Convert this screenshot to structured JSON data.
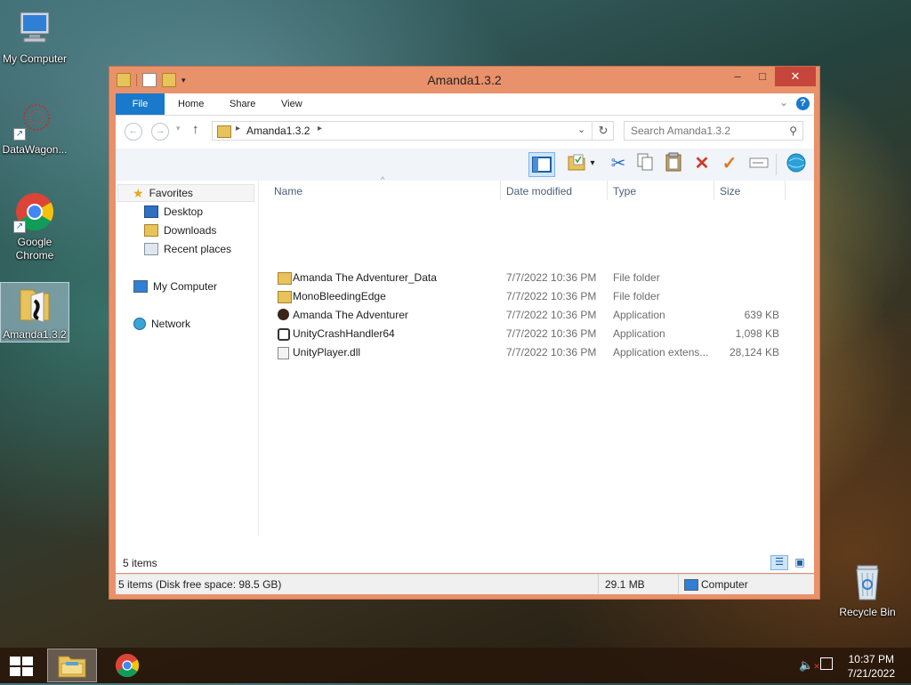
{
  "desktop": {
    "icons": [
      {
        "label": "My Computer",
        "icon": "computer-icon"
      },
      {
        "label": "DataWagon...",
        "icon": "datawagon-icon"
      },
      {
        "label": "Google Chrome",
        "icon": "chrome-icon"
      },
      {
        "label": "Amanda1.3.2",
        "icon": "folder-icon"
      },
      {
        "label": "Recycle Bin",
        "icon": "recycle-bin-icon"
      }
    ]
  },
  "window": {
    "title": "Amanda1.3.2",
    "controls": {
      "minimize": "–",
      "maximize": "□",
      "close": "✕"
    },
    "ribbon_tabs": [
      "File",
      "Home",
      "Share",
      "View"
    ],
    "address": {
      "crumb": "Amanda1.3.2"
    },
    "search": {
      "placeholder": "Search Amanda1.3.2"
    },
    "nav_pane": {
      "favorites": {
        "label": "Favorites",
        "items": [
          "Desktop",
          "Downloads",
          "Recent places"
        ]
      },
      "computer": "My Computer",
      "network": "Network"
    },
    "columns": [
      "Name",
      "Date modified",
      "Type",
      "Size"
    ],
    "files": [
      {
        "name": "Amanda The Adventurer_Data",
        "date": "7/7/2022 10:36 PM",
        "type": "File folder",
        "size": "",
        "icon": "folder-icon"
      },
      {
        "name": "MonoBleedingEdge",
        "date": "7/7/2022 10:36 PM",
        "type": "File folder",
        "size": "",
        "icon": "folder-icon"
      },
      {
        "name": "Amanda The Adventurer",
        "date": "7/7/2022 10:36 PM",
        "type": "Application",
        "size": "639 KB",
        "icon": "game-app-icon"
      },
      {
        "name": "UnityCrashHandler64",
        "date": "7/7/2022 10:36 PM",
        "type": "Application",
        "size": "1,098 KB",
        "icon": "unity-icon"
      },
      {
        "name": "UnityPlayer.dll",
        "date": "7/7/2022 10:36 PM",
        "type": "Application extens...",
        "size": "28,124 KB",
        "icon": "dll-icon"
      }
    ],
    "item_count": "5 items",
    "status": {
      "left": "5 items (Disk free space: 98.5 GB)",
      "size": "29.1 MB",
      "location": "Computer"
    }
  },
  "taskbar": {
    "clock_time": "10:37 PM",
    "clock_date": "7/21/2022"
  },
  "colors": {
    "accent": "#1979ca",
    "window_frame": "#e9916a",
    "close": "#c7463b"
  }
}
